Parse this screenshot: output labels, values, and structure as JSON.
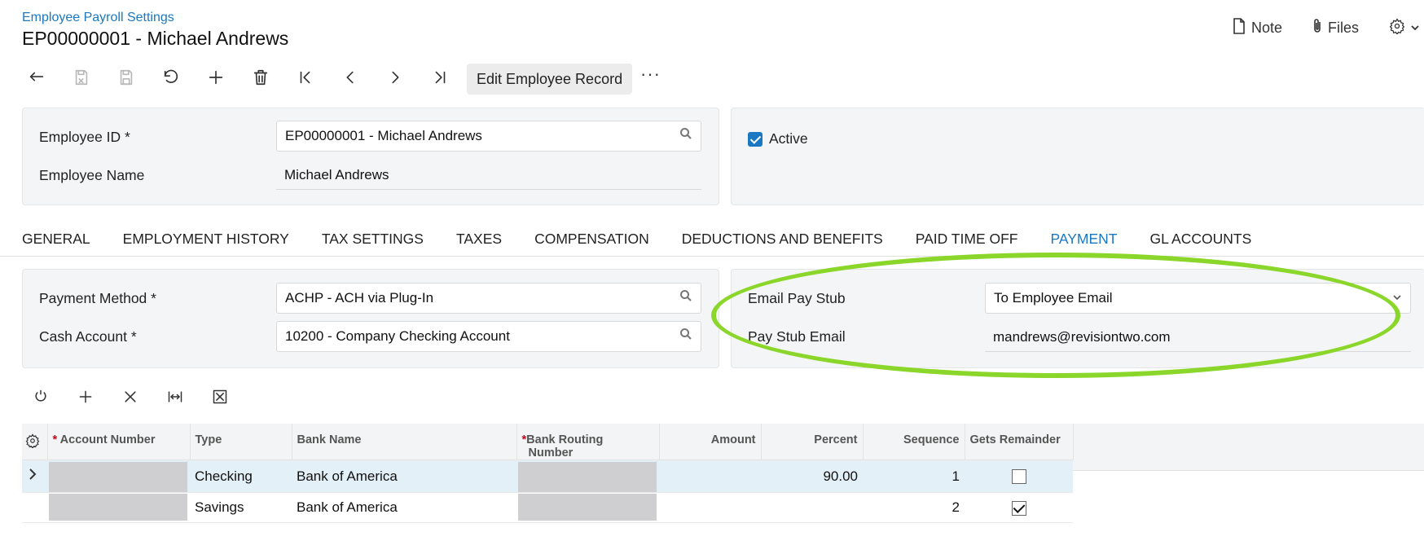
{
  "header": {
    "breadcrumb": "Employee Payroll Settings",
    "title": "EP00000001 - Michael Andrews",
    "note_label": "Note",
    "files_label": "Files"
  },
  "toolbar": {
    "edit_label": "Edit Employee Record",
    "more_label": "···"
  },
  "summary": {
    "employee_id_label": "Employee ID *",
    "employee_id_value": "EP00000001 - Michael Andrews",
    "employee_name_label": "Employee Name",
    "employee_name_value": "Michael Andrews",
    "active_label": "Active",
    "active_checked": true
  },
  "tabs": [
    {
      "label": "GENERAL",
      "active": false
    },
    {
      "label": "EMPLOYMENT HISTORY",
      "active": false
    },
    {
      "label": "TAX SETTINGS",
      "active": false
    },
    {
      "label": "TAXES",
      "active": false
    },
    {
      "label": "COMPENSATION",
      "active": false
    },
    {
      "label": "DEDUCTIONS AND BENEFITS",
      "active": false
    },
    {
      "label": "PAID TIME OFF",
      "active": false
    },
    {
      "label": "PAYMENT",
      "active": true
    },
    {
      "label": "GL ACCOUNTS",
      "active": false
    }
  ],
  "payment": {
    "payment_method_label": "Payment Method *",
    "payment_method_value": "ACHP - ACH via Plug-In",
    "cash_account_label": "Cash Account *",
    "cash_account_value": "10200 - Company Checking Account",
    "email_pay_stub_label": "Email Pay Stub",
    "email_pay_stub_value": "To Employee Email",
    "pay_stub_email_label": "Pay Stub Email",
    "pay_stub_email_value": "mandrews@revisiontwo.com"
  },
  "grid": {
    "columns": {
      "account_number": "Account Number",
      "type": "Type",
      "bank_name": "Bank Name",
      "bank_routing_1": "Bank Routing",
      "bank_routing_2": "Number",
      "amount": "Amount",
      "percent": "Percent",
      "sequence": "Sequence",
      "gets_remainder": "Gets Remainder"
    },
    "required_mark": "*",
    "rows": [
      {
        "type": "Checking",
        "bank_name": "Bank of America",
        "amount": "",
        "percent": "90.00",
        "sequence": "1",
        "gets_remainder": false
      },
      {
        "type": "Savings",
        "bank_name": "Bank of America",
        "amount": "",
        "percent": "",
        "sequence": "2",
        "gets_remainder": true
      }
    ]
  },
  "colors": {
    "accent": "#1a78c2",
    "highlight_ellipse": "#8bd62a",
    "selected_row": "#e4f0f8"
  }
}
